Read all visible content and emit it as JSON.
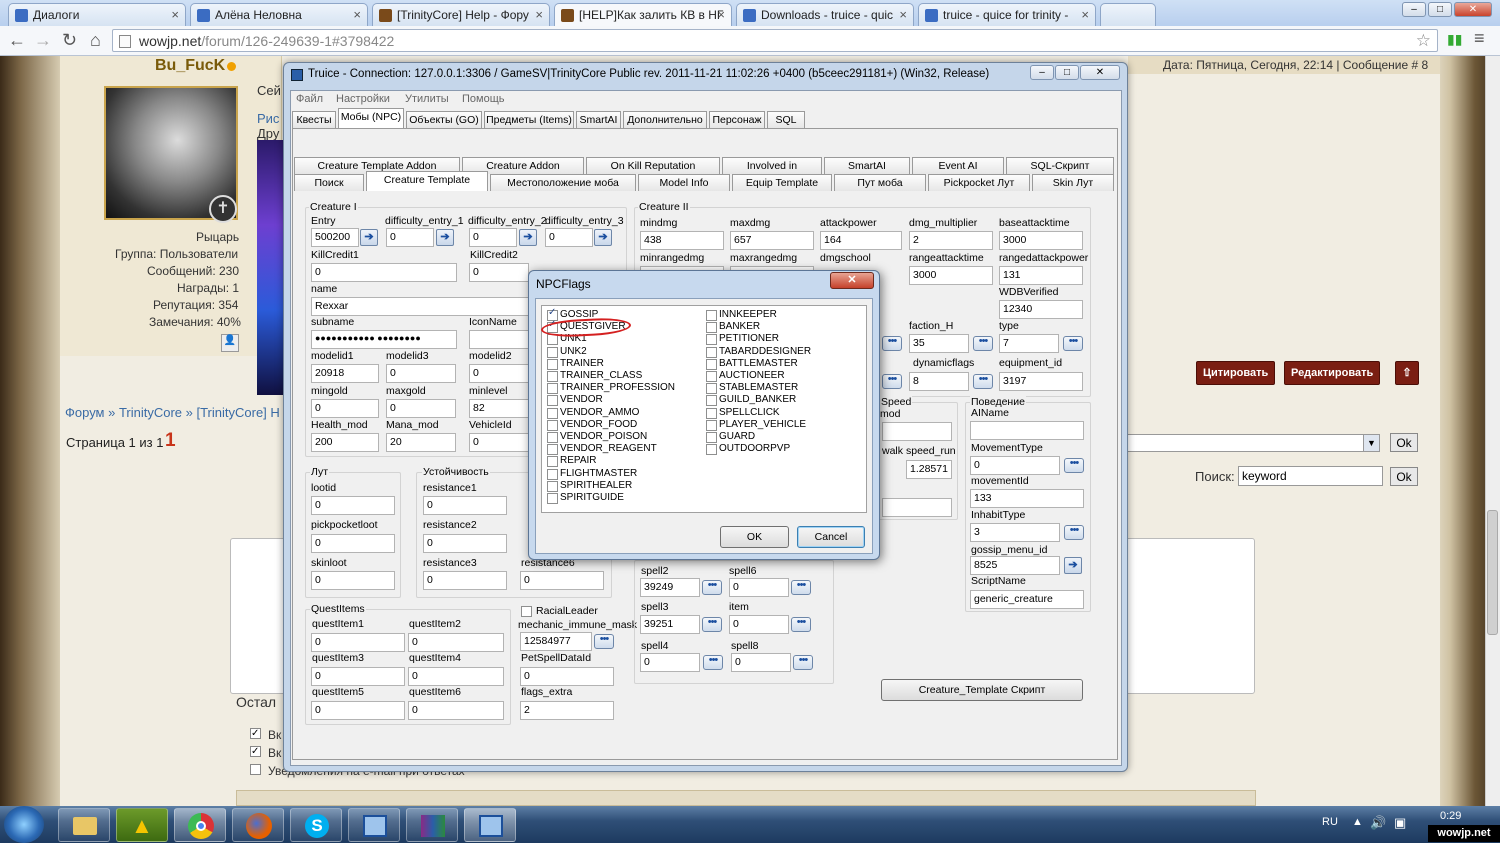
{
  "browser": {
    "tabs": [
      {
        "label": "Диалоги",
        "color": "#3b6cc2"
      },
      {
        "label": "Алёна Неловна",
        "color": "#3b6cc2"
      },
      {
        "label": "[TrinityCore] Help - Фору",
        "color": "#7a4a1a"
      },
      {
        "label": "[HELP]Как залить КВ в НГ",
        "color": "#7a4a1a"
      },
      {
        "label": "Downloads - truice - quic",
        "color": "#3b6cc2"
      },
      {
        "label": "truice - quice for trinity - ",
        "color": "#3b6cc2"
      }
    ],
    "url_host": "wowjp.net",
    "url_path": "/forum/126-249639-1#3798422"
  },
  "forum": {
    "username": "Bu_FucK",
    "rank": "Рыцарь",
    "group": "Группа: Пользователи",
    "messages": "Сообщений: 230",
    "awards": "Награды: 1",
    "reputation": "Репутация: 354",
    "warnings": "Замечания: 40%",
    "date_line": "Дата: Пятница, Сегодня, 22:14 | Сообщение # 8",
    "quote_btn": "Цитировать",
    "edit_btn": "Редактировать",
    "breadcrumb": "Форум » TrinityCore » [TrinityCore] H",
    "page_label": "Страница 1 из 1",
    "page_num": "1",
    "search_label": "Поиск:",
    "search_value": "keyword",
    "ok": "Ok",
    "partial_text_1": "Сей",
    "partial_text_2": "Рис",
    "partial_text_3": "Дру",
    "ostal": "Остал",
    "chk1": "Вк",
    "chk2": "Вк",
    "notify": "Уведомления на e-mail при ответах"
  },
  "app": {
    "title": "Truice - Connection: 127.0.0.1:3306 / GameSV|TrinityCore Public rev. 2011-11-21 11:02:26 +0400 (b5ceec291181+) (Win32, Release)",
    "menu": [
      "Файл",
      "Настройки",
      "Утилиты",
      "Помощь"
    ],
    "main_tabs": [
      "Квесты",
      "Мобы (NPC)",
      "Объекты (GO)",
      "Предметы (Items)",
      "SmartAI",
      "Дополнительно",
      "Персонаж",
      "SQL"
    ],
    "sub_tabs_row1": [
      "Creature Template Addon",
      "Creature Addon",
      "On Kill Reputation",
      "Involved in",
      "SmartAI",
      "Event AI",
      "SQL-Скрипт"
    ],
    "sub_tabs_row2": [
      "Поиск",
      "Creature Template",
      "Местоположение моба",
      "Model Info",
      "Equip Template",
      "Пут моба",
      "Pickpocket Лут",
      "Skin Лут"
    ],
    "creature1": {
      "title": "Creature I",
      "entry_l": "Entry",
      "entry": "500200",
      "de1_l": "difficulty_entry_1",
      "de1": "0",
      "de2_l": "difficulty_entry_2",
      "de2": "0",
      "de3_l": "difficulty_entry_3",
      "de3": "0",
      "kc1_l": "KillCredit1",
      "kc1": "0",
      "kc2_l": "KillCredit2",
      "kc2": "0",
      "name_l": "name",
      "name": "Rexxar",
      "sub_l": "subname",
      "sub": "●●●●●●●●●●● ●●●●●●●●",
      "icon_l": "IconName",
      "m1_l": "modelid1",
      "m1": "20918",
      "m3_l": "modelid3",
      "m3": "0",
      "m2_l": "modelid2",
      "m2": "0",
      "mg_l": "mingold",
      "mg": "0",
      "xg_l": "maxgold",
      "xg": "0",
      "ml_l": "minlevel",
      "ml": "82",
      "hm_l": "Health_mod",
      "hm": "200",
      "mm_l": "Mana_mod",
      "mm": "20",
      "vid_l": "VehicleId",
      "vid": "0"
    },
    "creature2": {
      "title": "Creature II",
      "mindmg_l": "mindmg",
      "mindmg": "438",
      "maxdmg_l": "maxdmg",
      "maxdmg": "657",
      "ap_l": "attackpower",
      "ap": "164",
      "dm_l": "dmg_multiplier",
      "dm": "2",
      "bat_l": "baseattacktime",
      "bat": "3000",
      "mrd_l": "minrangedmg",
      "xrd_l": "maxrangedmg",
      "ds_l": "dmgschool",
      "rat_l": "rangeattacktime",
      "rat": "3000",
      "rap_l": "rangedattackpower",
      "rap": "131",
      "wdb_l": "WDBVerified",
      "wdb": "12340",
      "fh_l": "faction_H",
      "fh": "35",
      "type_l": "type",
      "type": "7",
      "df_l": "dynamicflags",
      "df": "8",
      "eq_l": "equipment_id",
      "eq": "3197"
    },
    "speed": {
      "title": "Speed",
      "mod": "mod",
      "walk": "walk",
      "run_l": "speed_run",
      "run": "1.28571"
    },
    "behavior": {
      "title": "Поведение",
      "ai_l": "AIName",
      "mt_l": "MovementType",
      "mt": "0",
      "mid_l": "movementId",
      "mid": "133",
      "it_l": "InhabitType",
      "it": "3",
      "gm_l": "gossip_menu_id",
      "gm": "8525",
      "sn_l": "ScriptName",
      "sn": "generic_creature"
    },
    "loot": {
      "title": "Лут",
      "lid_l": "lootid",
      "lid": "0",
      "pp_l": "pickpocketloot",
      "pp": "0",
      "sk_l": "skinloot",
      "sk": "0"
    },
    "resist": {
      "title": "Устойчивость",
      "r1_l": "resistance1",
      "r1": "0",
      "r2_l": "resistance2",
      "r2": "0",
      "r3_l": "resistance3",
      "r3": "0",
      "r6_l": "resistance6",
      "r6": "0"
    },
    "quest": {
      "title": "QuestItems",
      "q1_l": "questItem1",
      "q1": "0",
      "q2_l": "questItem2",
      "q2": "0",
      "q3_l": "questItem3",
      "q3": "0",
      "q4_l": "questItem4",
      "q4": "0",
      "q5_l": "questItem5",
      "q5": "0",
      "q6_l": "questItem6",
      "q6": "0"
    },
    "misc": {
      "rl": "RacialLeader",
      "mim_l": "mechanic_immune_mask",
      "mim": "12584977",
      "psd_l": "PetSpellDataId",
      "psd": "0",
      "fe_l": "flags_extra",
      "fe": "2"
    },
    "spells": {
      "s2_l": "spell2",
      "s2": "39249",
      "s6_l": "spell6",
      "s6": "0",
      "s3_l": "spell3",
      "s3": "39251",
      "it_l": "item",
      "it": "0",
      "s4_l": "spell4",
      "s4": "0",
      "s8_l": "spell8",
      "s8": "0"
    },
    "script_btn": "Creature_Template Скрипт"
  },
  "dialog": {
    "title": "NPCFlags",
    "flags_left": [
      {
        "name": "GOSSIP",
        "checked": true
      },
      {
        "name": "QUESTGIVER",
        "checked": true
      },
      {
        "name": "UNK1",
        "checked": false
      },
      {
        "name": "UNK2",
        "checked": false
      },
      {
        "name": "TRAINER",
        "checked": false
      },
      {
        "name": "TRAINER_CLASS",
        "checked": false
      },
      {
        "name": "TRAINER_PROFESSION",
        "checked": false
      },
      {
        "name": "VENDOR",
        "checked": false
      },
      {
        "name": "VENDOR_AMMO",
        "checked": false
      },
      {
        "name": "VENDOR_FOOD",
        "checked": false
      },
      {
        "name": "VENDOR_POISON",
        "checked": false
      },
      {
        "name": "VENDOR_REAGENT",
        "checked": false
      },
      {
        "name": "REPAIR",
        "checked": false
      },
      {
        "name": "FLIGHTMASTER",
        "checked": false
      },
      {
        "name": "SPIRITHEALER",
        "checked": false
      },
      {
        "name": "SPIRITGUIDE",
        "checked": false
      }
    ],
    "flags_right": [
      {
        "name": "INNKEEPER",
        "checked": false
      },
      {
        "name": "BANKER",
        "checked": false
      },
      {
        "name": "PETITIONER",
        "checked": false
      },
      {
        "name": "TABARDDESIGNER",
        "checked": false
      },
      {
        "name": "BATTLEMASTER",
        "checked": false
      },
      {
        "name": "AUCTIONEER",
        "checked": false
      },
      {
        "name": "STABLEMASTER",
        "checked": false
      },
      {
        "name": "GUILD_BANKER",
        "checked": false
      },
      {
        "name": "SPELLCLICK",
        "checked": false
      },
      {
        "name": "PLAYER_VEHICLE",
        "checked": false
      },
      {
        "name": "GUARD",
        "checked": false
      },
      {
        "name": "OUTDOORPVP",
        "checked": false
      }
    ],
    "ok": "OK",
    "cancel": "Cancel"
  },
  "taskbar": {
    "lang": "RU",
    "time": "0:29",
    "watermark": "wowjp.net"
  },
  "colors": {
    "accent_red": "#c8341a",
    "forum_link": "#3a6ba5",
    "highlight_circle": "#d42020"
  }
}
